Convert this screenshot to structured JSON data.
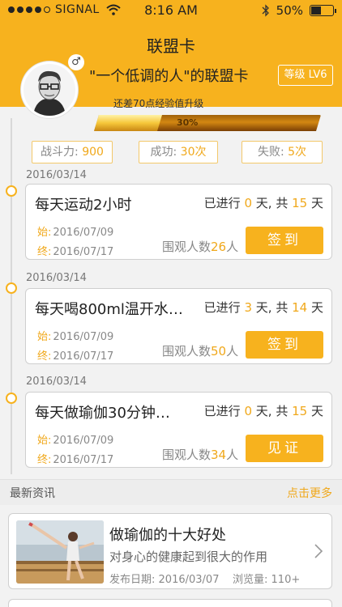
{
  "status_bar": {
    "carrier": "SIGNAL",
    "time": "8:16 AM",
    "battery": "50%",
    "battery_level": 0.5,
    "signal_bars": 4
  },
  "nav": {
    "title": "联盟卡"
  },
  "profile": {
    "gender_symbol": "♂",
    "card_name": "\"一个低调的人\"的联盟卡",
    "level": "等级 LV6",
    "exp_hint": "还差70点经验值升级",
    "exp_progress": 0.3,
    "exp_label": "30%"
  },
  "stats": {
    "power_label": "战斗力:",
    "power_value": "900",
    "success_label": "成功:",
    "success_value": "30次",
    "fail_label": "失败:",
    "fail_value": "5次"
  },
  "tasks": [
    {
      "date": "2016/03/14",
      "title": "每天运动2小时",
      "progress_prefix": "已进行",
      "done": "0",
      "day_unit": "天",
      "total_prefix": ", 共",
      "total": "15",
      "start_label": "始:",
      "start": "2016/07/09",
      "end_label": "终:",
      "end": "2016/07/17",
      "watchers_label": "围观人数",
      "watchers": "26",
      "watchers_unit": "人",
      "button": "签到"
    },
    {
      "date": "2016/03/14",
      "title": "每天喝800ml温开水…",
      "progress_prefix": "已进行",
      "done": "3",
      "day_unit": "天",
      "total_prefix": ", 共",
      "total": "14",
      "start_label": "始:",
      "start": "2016/07/09",
      "end_label": "终:",
      "end": "2016/07/17",
      "watchers_label": "围观人数",
      "watchers": "50",
      "watchers_unit": "人",
      "button": "签到"
    },
    {
      "date": "2016/03/14",
      "title": "每天做瑜伽30分钟…",
      "progress_prefix": "已进行",
      "done": "0",
      "day_unit": "天",
      "total_prefix": ", 共",
      "total": "15",
      "start_label": "始:",
      "start": "2016/07/09",
      "end_label": "终:",
      "end": "2016/07/17",
      "watchers_label": "围观人数",
      "watchers": "34",
      "watchers_unit": "人",
      "button": "见证"
    }
  ],
  "news": {
    "section_title": "最新资讯",
    "more": "点击更多",
    "items": [
      {
        "title": "做瑜伽的十大好处",
        "subtitle": "对身心的健康起到很大的作用",
        "date_label": "发布日期:",
        "date": "2016/03/07",
        "views_label": "浏览量:",
        "views": "110+"
      }
    ]
  },
  "colors": {
    "accent": "#f7b21e",
    "accent_text": "#f0a81b",
    "background": "#f2f2f2"
  }
}
